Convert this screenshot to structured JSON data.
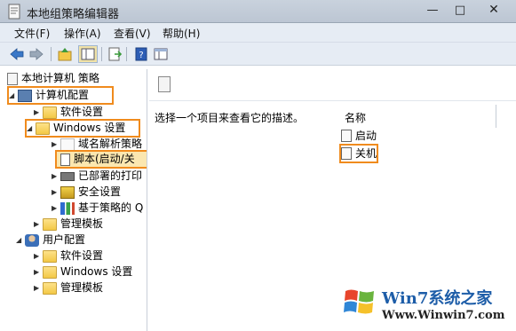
{
  "window": {
    "title": "本地组策略编辑器",
    "controls": {
      "minimize": "—",
      "maximize": "□",
      "close": "✕"
    }
  },
  "menu": {
    "items": [
      "文件(F)",
      "操作(A)",
      "查看(V)",
      "帮助(H)"
    ]
  },
  "toolbar": {
    "icons": [
      "back-icon",
      "forward-icon",
      "up-folder-icon",
      "show-hide-tree-icon",
      "export-list-icon",
      "help-icon",
      "console-tree-icon"
    ]
  },
  "tree": {
    "root": "本地计算机 策略",
    "computer_config": "计算机配置",
    "software_settings": "软件设置",
    "windows_settings": "Windows 设置",
    "dns_policy": "域名解析策略",
    "scripts": "脚本(启动/关",
    "deployed_printers": "已部署的打印",
    "security_settings": "安全设置",
    "policy_qos": "基于策略的 Q",
    "admin_templates": "管理模板",
    "user_config": "用户配置",
    "user_software_settings": "软件设置",
    "user_windows_settings": "Windows 设置",
    "user_admin_templates": "管理模板"
  },
  "content": {
    "description": "选择一个项目来查看它的描述。",
    "column_name": "名称",
    "items": [
      "启动",
      "关机"
    ]
  },
  "watermark": {
    "title": "Win7系统之家",
    "url": "Www.Winwin7.com"
  },
  "colors": {
    "highlight": "#f08b1d",
    "folder": "#f3c846",
    "menubar": "#e6ecf4"
  }
}
